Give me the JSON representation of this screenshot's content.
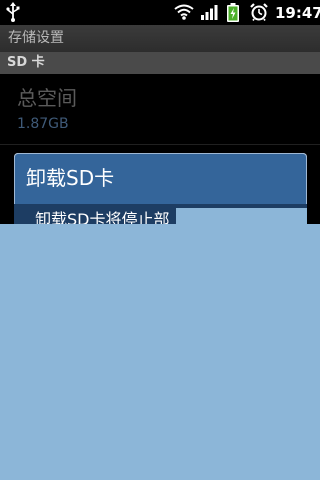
{
  "status_bar": {
    "clock": "19:47",
    "icons": [
      "usb-icon",
      "wifi-icon",
      "signal-icon",
      "battery-charging-icon",
      "alarm-icon"
    ]
  },
  "title_bar": {
    "title": "存储设置"
  },
  "category": {
    "label": "SD 卡"
  },
  "total_space": {
    "title": "总空间",
    "summary": "1.87GB"
  },
  "dialog": {
    "title": "卸载SD卡",
    "message": "卸载SD卡将停止部"
  },
  "colors": {
    "dialog_title_bg": "#34659a",
    "dialog_body_bg": "#1d3d63",
    "overlay_panel": "#8cb6d8",
    "summary_text": "#3f5a78"
  }
}
